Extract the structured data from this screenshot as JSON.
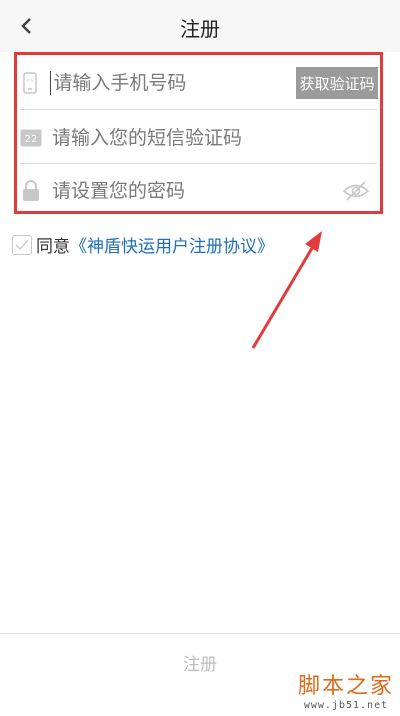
{
  "header": {
    "title": "注册",
    "back_icon": "chevron-left-icon"
  },
  "form": {
    "phone": {
      "placeholder": "请输入手机号码",
      "icon": "phone-icon"
    },
    "get_code_label": "获取验证码",
    "sms_code": {
      "placeholder": "请输入您的短信验证码",
      "icon": "sms-badge-icon",
      "icon_text": "22"
    },
    "password": {
      "placeholder": "请设置您的密码",
      "icon": "lock-icon",
      "toggle_icon": "eye-off-icon"
    }
  },
  "agreement": {
    "prefix": "同意",
    "link": "《神盾快运用户注册协议》",
    "checked": false
  },
  "footer": {
    "submit_label": "注册"
  },
  "watermark": {
    "main": "脚本之家",
    "url": "www.jb51.net"
  },
  "colors": {
    "highlight": "#e23b3b",
    "link": "#1f6fb8",
    "button_gray": "#9b9b9b",
    "watermark": "#e06a1a"
  }
}
